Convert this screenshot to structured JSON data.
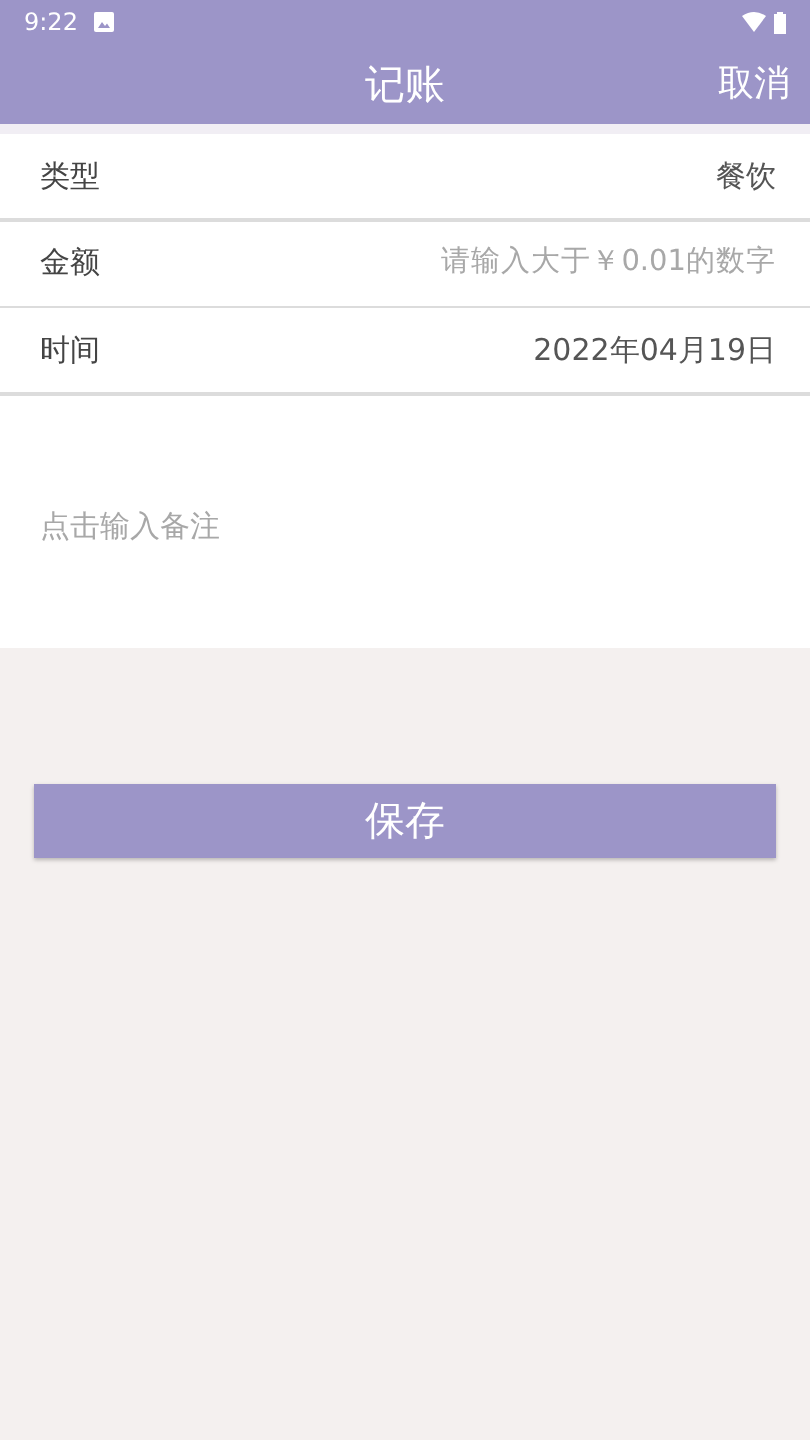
{
  "status_bar": {
    "time": "9:22"
  },
  "header": {
    "title": "记账",
    "action": "取消"
  },
  "fields": [
    {
      "kind": "value",
      "label": "类型",
      "value": "餐饮"
    },
    {
      "kind": "input",
      "label": "金额",
      "placeholder": "请输入大于￥0.01的数字"
    },
    {
      "kind": "value",
      "label": "时间",
      "value": "2022年04月19日"
    }
  ],
  "note": {
    "placeholder": "点击输入备注"
  },
  "buttons": [
    "保存"
  ]
}
